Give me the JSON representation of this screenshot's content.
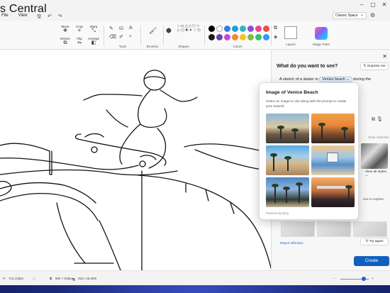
{
  "watermark": "s Central",
  "menu": {
    "file": "File",
    "view": "View"
  },
  "workspace": {
    "selected": "Classic Space"
  },
  "ribbon": {
    "tools": {
      "move": "Move",
      "crop": "Crop",
      "warp": "Warp",
      "resize": "Resize",
      "flip": "Flip",
      "arrange": "Arrange"
    },
    "groups": {
      "tools": "Tools",
      "brushes": "Brushes",
      "shapes": "Shapes",
      "colors": "Colors",
      "layers": "Layers",
      "magic": "Magic Paint"
    },
    "colors": {
      "row1": [
        "#000000",
        "#ffffff",
        "#3a7bd5",
        "#1aa0e6",
        "#2fb3c6",
        "#8c4fd1",
        "#e64a8a",
        "#ef4b4b"
      ],
      "row2": [
        "#1b1b1b",
        "#6b3fb0",
        "#c64bd0",
        "#f08a2a",
        "#f5c518",
        "#7cc03a",
        "#34c06a",
        "#2a9df4"
      ]
    }
  },
  "status": {
    "cursor": "714,126px",
    "size": "962 × 635px",
    "file_size": "Size: 25.4KB"
  },
  "panel": {
    "question": "What do you want to see?",
    "surprise": "Surprise me",
    "prompt_prefix": "A sketch of a skater in",
    "prompt_chip": "Venice beach",
    "prompt_suffix": "during the",
    "clear_selection": "Clear selection",
    "view_all": "View all styles",
    "explore": "one to explore",
    "report": "Report offensive",
    "try_again": "Try again",
    "create": "Create"
  },
  "flyout": {
    "title": "Image of Venice Beach",
    "description": "Select an image to use along with the prompt to create your artwork",
    "footer": "Powered by Bing"
  }
}
